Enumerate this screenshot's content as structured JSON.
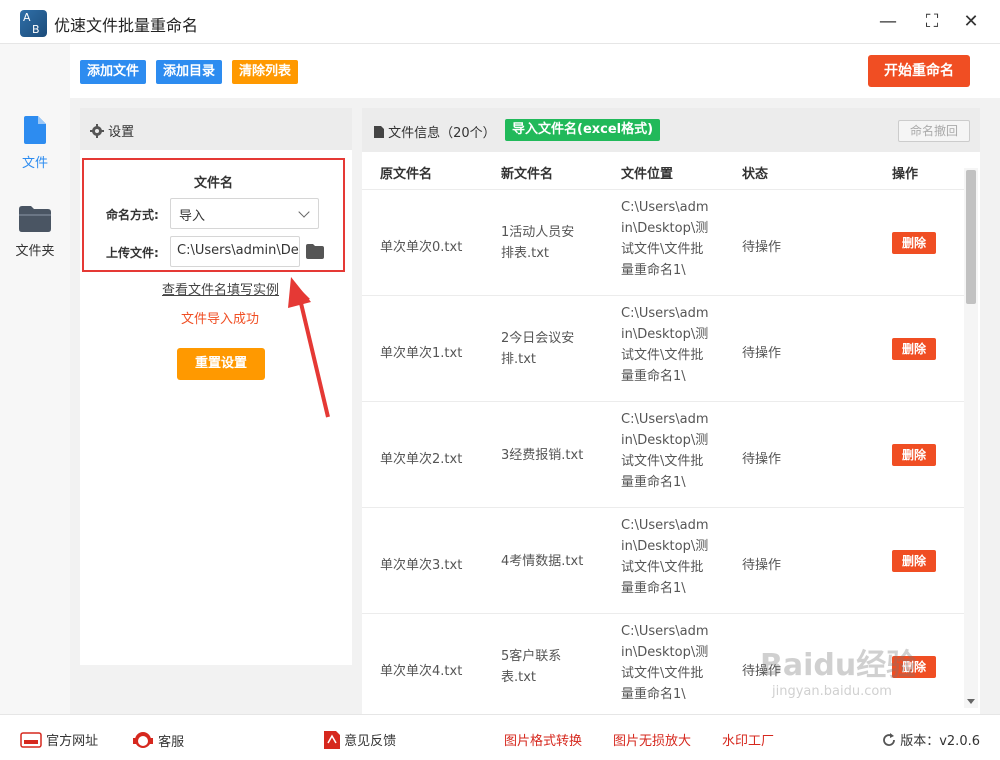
{
  "app": {
    "title": "优速文件批量重命名",
    "logo_a": "A",
    "logo_b": "B"
  },
  "window": {
    "minimize": "—",
    "maximize": "⛶",
    "close": "✕"
  },
  "nav": {
    "file_label": "文件",
    "folder_label": "文件夹"
  },
  "toolbar": {
    "add_file": "添加文件",
    "add_dir": "添加目录",
    "clear_list": "清除列表",
    "start": "开始重命名"
  },
  "settings": {
    "header": "设置",
    "section_title": "文件名",
    "naming_label": "命名方式:",
    "naming_value": "导入",
    "upload_label": "上传文件:",
    "upload_value": "C:\\Users\\admin\\Desktop",
    "example_link": "查看文件名填写实例",
    "import_status": "文件导入成功",
    "reset_button": "重置设置"
  },
  "filepanel": {
    "title": "文件信息（20个）",
    "import_excel": "导入文件名(excel格式)",
    "undo": "命名撤回",
    "columns": [
      "原文件名",
      "新文件名",
      "文件位置",
      "状态",
      "操作"
    ],
    "rows": [
      {
        "orig": "单次单次0.txt",
        "new": "1活动人员安排表.txt",
        "loc": "C:\\Users\\admin\\Desktop\\测试文件\\文件批量重命名1\\",
        "status": "待操作",
        "action": "删除"
      },
      {
        "orig": "单次单次1.txt",
        "new": "2今日会议安排.txt",
        "loc": "C:\\Users\\admin\\Desktop\\测试文件\\文件批量重命名1\\",
        "status": "待操作",
        "action": "删除"
      },
      {
        "orig": "单次单次2.txt",
        "new": "3经费报销.txt",
        "loc": "C:\\Users\\admin\\Desktop\\测试文件\\文件批量重命名1\\",
        "status": "待操作",
        "action": "删除"
      },
      {
        "orig": "单次单次3.txt",
        "new": "4考情数据.txt",
        "loc": "C:\\Users\\admin\\Desktop\\测试文件\\文件批量重命名1\\",
        "status": "待操作",
        "action": "删除"
      },
      {
        "orig": "单次单次4.txt",
        "new": "5客户联系表.txt",
        "loc": "C:\\Users\\admin\\Desktop\\测试文件\\文件批量重命名1\\",
        "status": "待操作",
        "action": "删除"
      }
    ]
  },
  "bottombar": {
    "website": "官方网址",
    "service": "客服",
    "feedback": "意见反馈",
    "img_convert": "图片格式转换",
    "img_enlarge": "图片无损放大",
    "watermark_tool": "水印工厂",
    "version": "版本：v2.0.6"
  },
  "watermark": {
    "logo": "Baidu经验",
    "url": "jingyan.baidu.com"
  },
  "colors": {
    "blue": "#2d8cf0",
    "orange": "#ff9900",
    "red": "#f04e23",
    "green": "#21b95a"
  }
}
